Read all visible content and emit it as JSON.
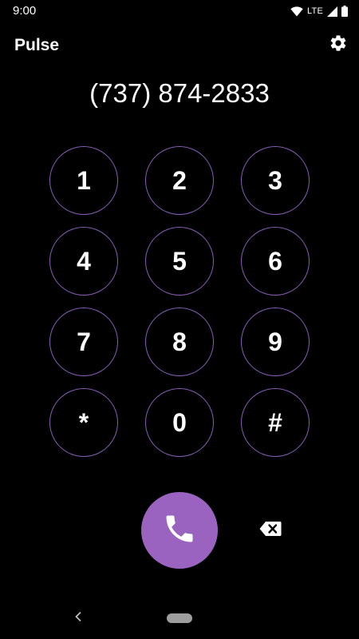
{
  "status_bar": {
    "time": "9:00",
    "network": "LTE",
    "icons": [
      "wifi-icon",
      "lte-icon",
      "signal-icon",
      "battery-icon"
    ]
  },
  "app_bar": {
    "title": "Pulse",
    "settings_icon": "gear-icon"
  },
  "dialer": {
    "number": "(737) 874-2833",
    "keys": [
      "1",
      "2",
      "3",
      "4",
      "5",
      "6",
      "7",
      "8",
      "9",
      "*",
      "0",
      "#"
    ],
    "call_icon": "phone-icon",
    "backspace_icon": "backspace-icon"
  },
  "nav_bar": {
    "back_icon": "chevron-left-icon",
    "home_icon": "home-pill-icon"
  },
  "colors": {
    "background": "#000000",
    "accent": "#9a63bf",
    "key_border": "#8a5cb8",
    "text": "#ffffff"
  }
}
